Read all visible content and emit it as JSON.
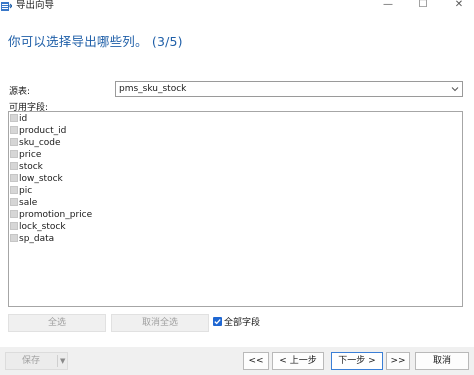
{
  "window": {
    "title": "导出向导",
    "minimize_glyph": "—",
    "maximize_glyph": "☐",
    "close_glyph": "✕"
  },
  "header": {
    "title": "你可以选择导出哪些列。 (3/5)"
  },
  "source": {
    "label": "源表:",
    "value": "pms_sku_stock"
  },
  "fields": {
    "label": "可用字段:",
    "items": [
      {
        "name": "id"
      },
      {
        "name": "product_id"
      },
      {
        "name": "sku_code"
      },
      {
        "name": "price"
      },
      {
        "name": "stock"
      },
      {
        "name": "low_stock"
      },
      {
        "name": "pic"
      },
      {
        "name": "sale"
      },
      {
        "name": "promotion_price"
      },
      {
        "name": "lock_stock"
      },
      {
        "name": "sp_data"
      }
    ]
  },
  "actions": {
    "select_all": "全选",
    "deselect_all": "取消全选",
    "all_fields_label": "全部字段",
    "all_fields_checked": true
  },
  "footer": {
    "save": "保存",
    "first": "<<",
    "prev": "< 上一步",
    "next": "下一步 >",
    "last": ">>",
    "cancel": "取消"
  },
  "colors": {
    "heading": "#1f5fa8",
    "accent": "#1f67d2"
  },
  "icons": {
    "app": "export-wizard-icon",
    "dropdown": "chevron-down-icon",
    "checkbox": "checkbox-icon"
  }
}
